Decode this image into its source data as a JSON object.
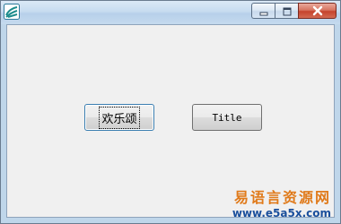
{
  "window": {
    "title": "",
    "icon": "app-logo-icon"
  },
  "caption_buttons": {
    "minimize_icon": "minimize-icon",
    "maximize_icon": "maximize-icon",
    "close_icon": "close-icon"
  },
  "buttons": {
    "button1_label": "欢乐颂",
    "button2_label": "Title"
  },
  "watermark": {
    "title": "易语言资源网",
    "url": "www.e5a5x.com"
  },
  "colors": {
    "titlebar": "#c7dcf0",
    "client_bg": "#f0f0f0",
    "close_red": "#c5422c",
    "watermark_orange": "#e07a1a",
    "watermark_blue": "#1a4f9c"
  }
}
